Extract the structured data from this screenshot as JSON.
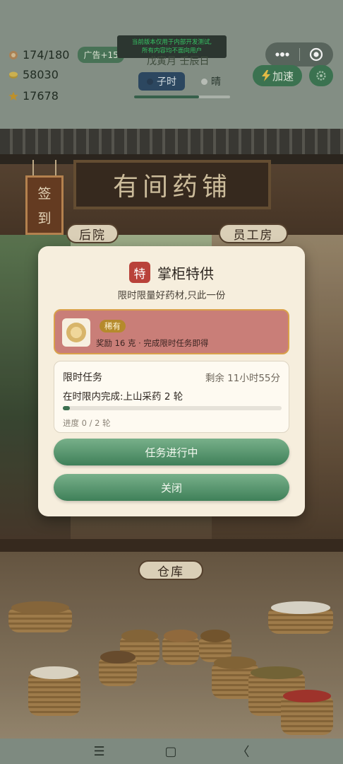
{
  "hud": {
    "health": "174/180",
    "ad_bonus": "广告+15",
    "coins": "58030",
    "stars": "17678",
    "dev_notice_line1": "当前版本仅用于内部开发测试,",
    "dev_notice_line2": "所有内容均不面向用户",
    "date": "戊寅月 壬辰日",
    "slot_active": "子时",
    "slot_weather": "晴",
    "time_progress": 0.68,
    "speed_label": "加速",
    "more_icon": "more-dots-icon",
    "target_icon": "record-target-icon"
  },
  "scene": {
    "shop_sign": "有间药铺",
    "checkin_top": "签",
    "checkin_bottom": "到",
    "back_yard": "后院",
    "staff_room": "员工房",
    "warehouse": "仓库"
  },
  "modal": {
    "tag": "特",
    "title": "掌柜特供",
    "subtitle": "限时限量好药材,只此一份",
    "reward": {
      "rarity": "稀有",
      "desc": "奖励 16 克 · 完成限时任务即得"
    },
    "task": {
      "title": "限时任务",
      "remaining": "剩余 11小时55分",
      "desc": "在时限内完成:上山采药 2 轮",
      "progress_text": "进度 0 / 2 轮",
      "progress_value": 0
    },
    "primary_button": "任务进行中",
    "close_button": "关闭"
  },
  "sysnav": {
    "menu": "☰",
    "home": "▢",
    "back": "〈"
  },
  "colors": {
    "accent_green": "#3f8059",
    "reward_card": "#c97e78",
    "tag_red": "#b9423a"
  }
}
